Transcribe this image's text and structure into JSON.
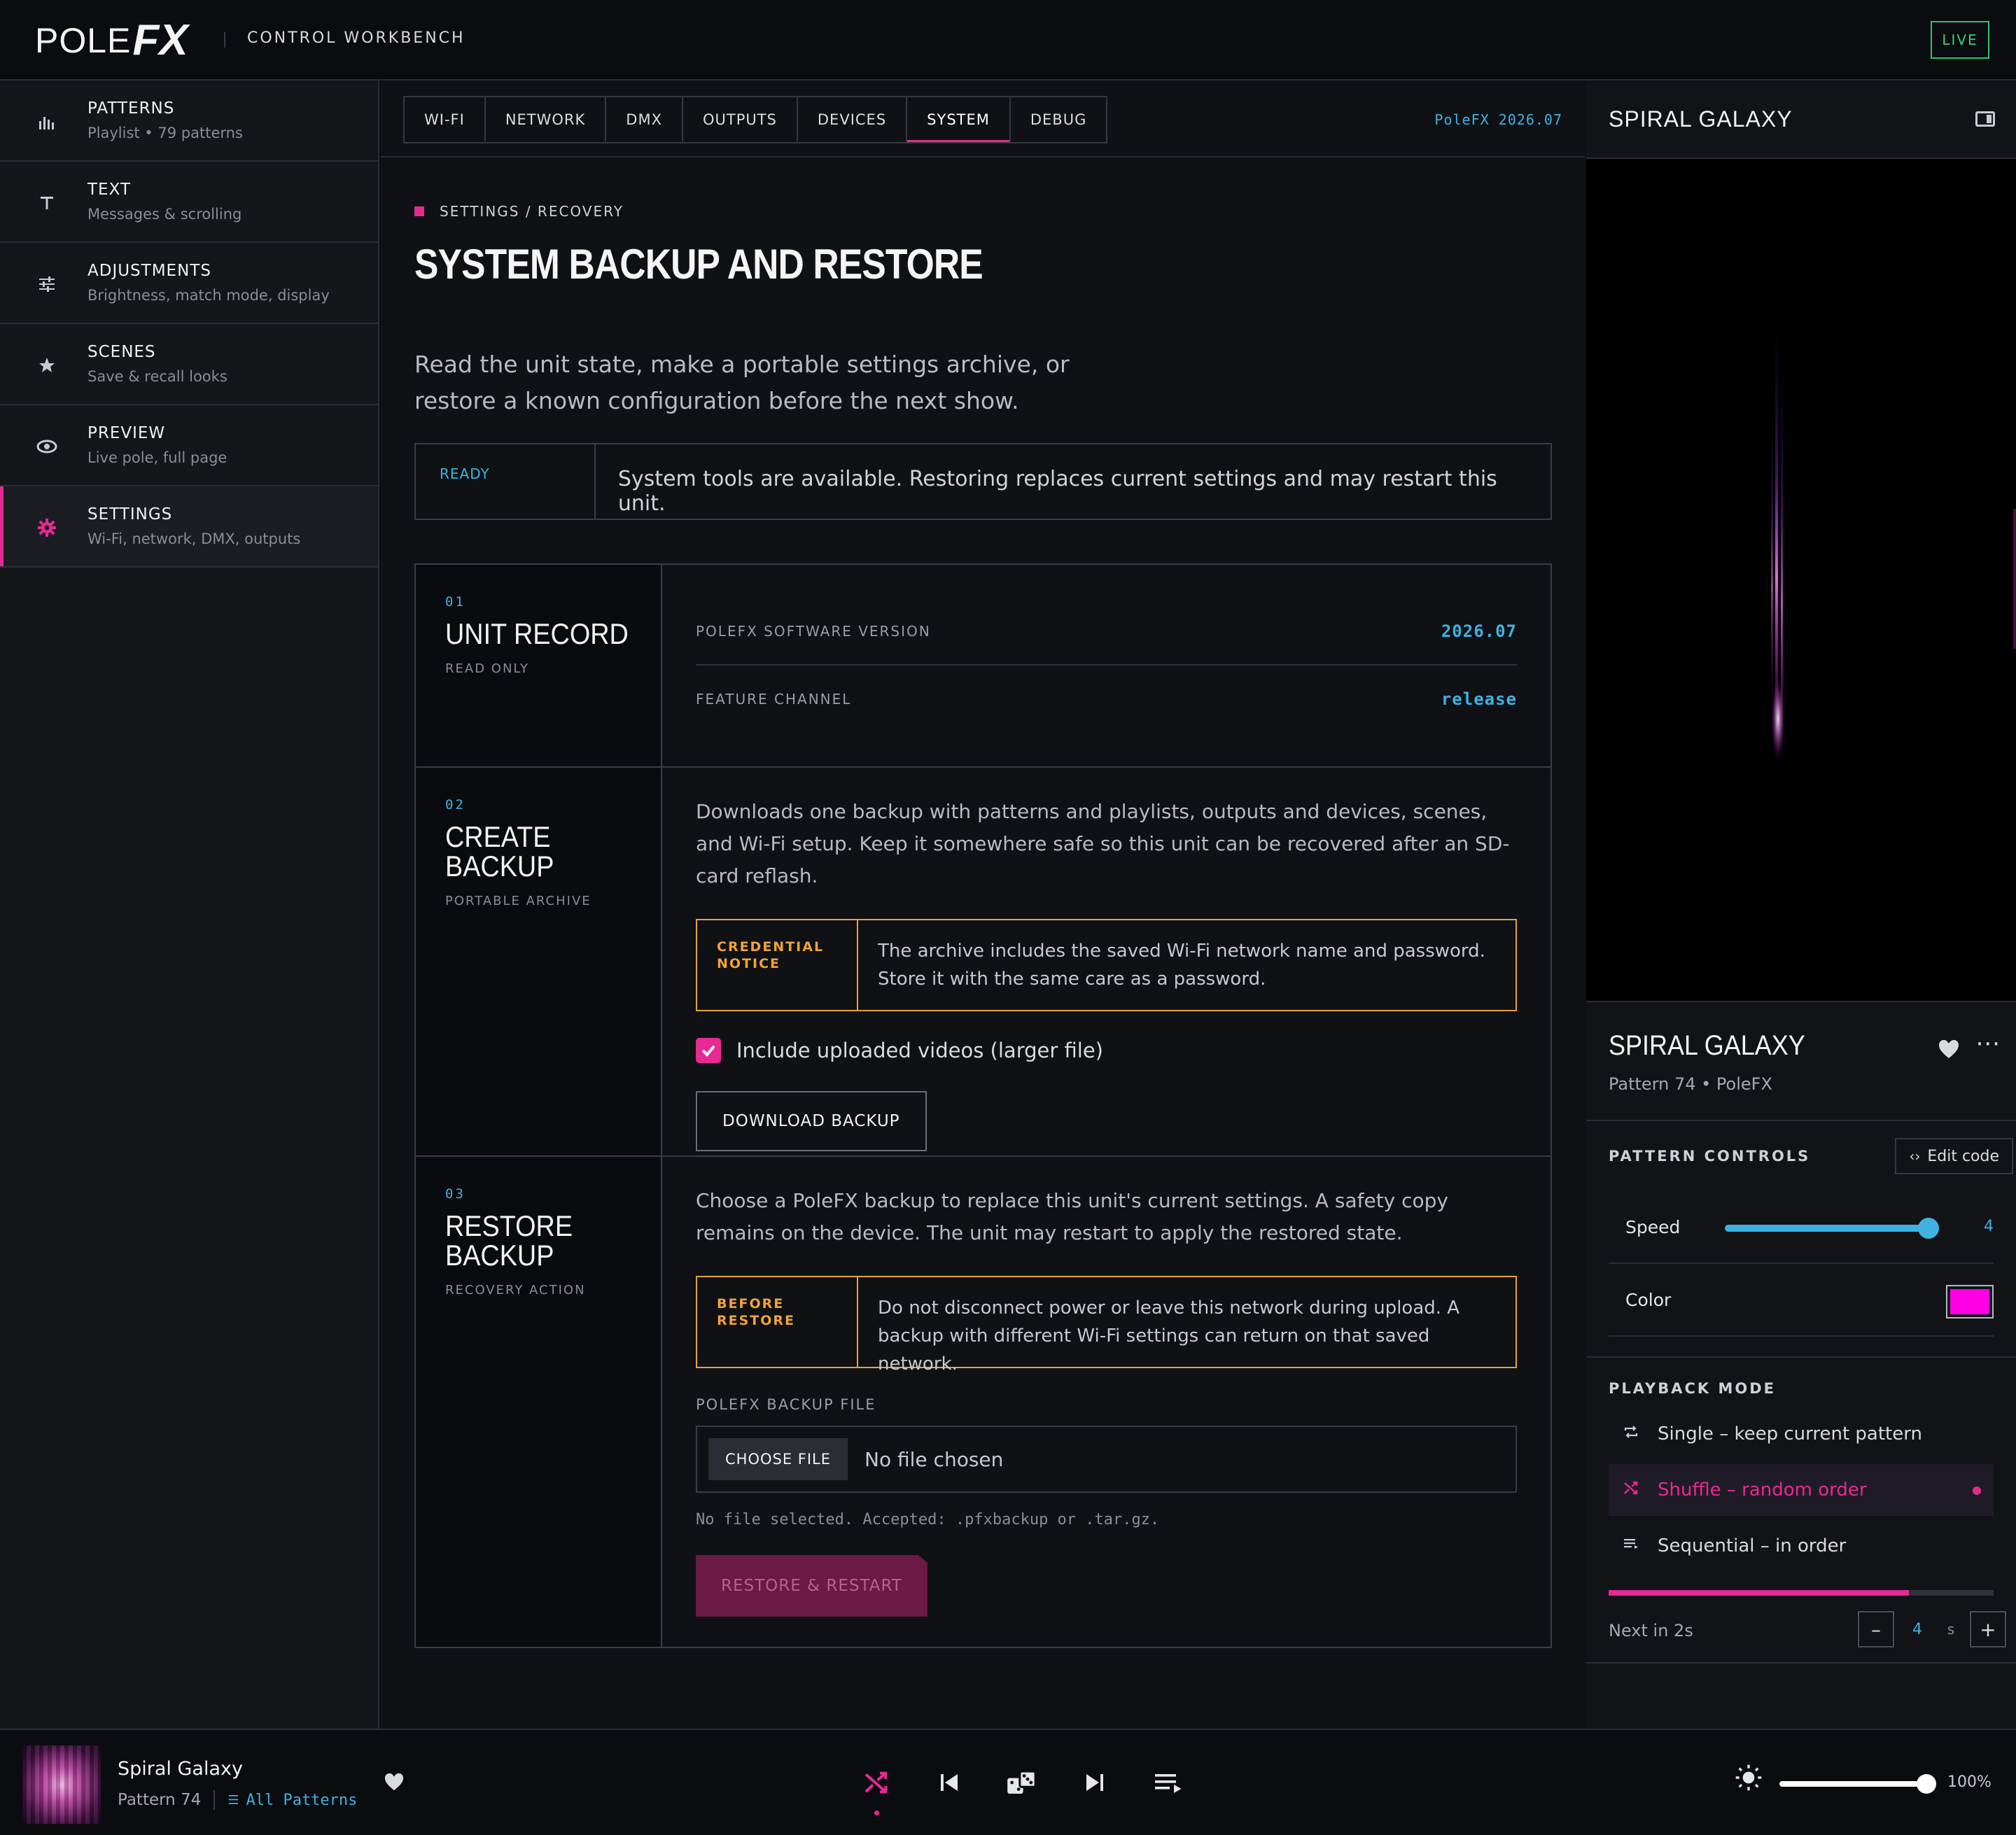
{
  "topbar": {
    "logo_main": "POLE",
    "logo_fx": "FX",
    "title": "CONTROL WORKBENCH",
    "live_badge": "LIVE"
  },
  "sidebar": {
    "items": [
      {
        "label": "PATTERNS",
        "sub": "Playlist • 79 patterns",
        "icon": "bars-icon"
      },
      {
        "label": "TEXT",
        "sub": "Messages & scrolling",
        "icon": "text-icon"
      },
      {
        "label": "ADJUSTMENTS",
        "sub": "Brightness, match mode, display",
        "icon": "sliders-icon"
      },
      {
        "label": "SCENES",
        "sub": "Save & recall looks",
        "icon": "star-icon"
      },
      {
        "label": "PREVIEW",
        "sub": "Live pole, full page",
        "icon": "eye-icon"
      },
      {
        "label": "SETTINGS",
        "sub": "Wi-Fi, network, DMX, outputs",
        "icon": "gear-icon"
      }
    ],
    "active_index": 5
  },
  "main": {
    "tabs": [
      "WI-FI",
      "NETWORK",
      "DMX",
      "OUTPUTS",
      "DEVICES",
      "SYSTEM",
      "DEBUG"
    ],
    "active_tab": "SYSTEM",
    "version_tag": "PoleFX 2026.07",
    "breadcrumb": "SETTINGS / RECOVERY",
    "title": "SYSTEM BACKUP AND RESTORE",
    "description": "Read the unit state, make a portable settings archive, or restore a known configuration before the next show.",
    "status": {
      "label": "READY",
      "text": "System tools are available. Restoring replaces current settings and may restart this unit."
    },
    "unit_record": {
      "num": "01",
      "title": "UNIT RECORD",
      "sub": "READ ONLY",
      "rows": [
        {
          "key": "POLEFX SOFTWARE VERSION",
          "value": "2026.07"
        },
        {
          "key": "FEATURE CHANNEL",
          "value": "release"
        }
      ]
    },
    "create_backup": {
      "num": "02",
      "title_line1": "CREATE",
      "title_line2": "BACKUP",
      "sub": "PORTABLE ARCHIVE",
      "body": "Downloads one backup with patterns and playlists, outputs and devices, scenes, and Wi-Fi setup. Keep it somewhere safe so this unit can be recovered after an SD-card reflash.",
      "notice_label_1": "CREDENTIAL",
      "notice_label_2": "NOTICE",
      "notice_text": "The archive includes the saved Wi-Fi network name and password. Store it with the same care as a password.",
      "checkbox_label": "Include uploaded videos (larger file)",
      "checkbox_checked": true,
      "button": "DOWNLOAD BACKUP"
    },
    "restore_backup": {
      "num": "03",
      "title_line1": "RESTORE",
      "title_line2": "BACKUP",
      "sub": "RECOVERY ACTION",
      "body": "Choose a PoleFX backup to replace this unit's current settings. A safety copy remains on the device. The unit may restart to apply the restored state.",
      "notice_label_1": "BEFORE",
      "notice_label_2": "RESTORE",
      "notice_text": "Do not disconnect power or leave this network during upload. A backup with different Wi-Fi settings can return on that saved network.",
      "field_label": "POLEFX BACKUP FILE",
      "choose_button": "CHOOSE FILE",
      "file_status": "No file chosen",
      "hint": "No file selected. Accepted: .pfxbackup or .tar.gz.",
      "restore_button": "RESTORE & RESTART"
    }
  },
  "right_panel": {
    "header_title": "SPIRAL GALAXY",
    "pattern_name": "SPIRAL GALAXY",
    "pattern_meta": "Pattern 74 • PoleFX",
    "controls_title": "PATTERN CONTROLS",
    "edit_code": "Edit code",
    "speed_label": "Speed",
    "speed_value": "4",
    "speed_fraction": 0.97,
    "color_label": "Color",
    "color_value": "#ff00e6",
    "playback_title": "PLAYBACK MODE",
    "modes": [
      {
        "label": "Single – keep current pattern",
        "icon": "repeat-icon"
      },
      {
        "label": "Shuffle – random order",
        "icon": "shuffle-icon"
      },
      {
        "label": "Sequential – in order",
        "icon": "list-icon"
      }
    ],
    "active_mode": 1,
    "progress_fraction": 0.78,
    "next_text": "Next in 2s",
    "interval_value": "4",
    "interval_unit": "s"
  },
  "player": {
    "title": "Spiral Galaxy",
    "meta": "Pattern 74",
    "playlist_link": "All Patterns",
    "brightness": "100%",
    "brightness_fraction": 1.0
  },
  "colors": {
    "accent": "#e62a93",
    "info": "#3fb2e0",
    "warning": "#e8a13c",
    "live": "#34d07f"
  }
}
